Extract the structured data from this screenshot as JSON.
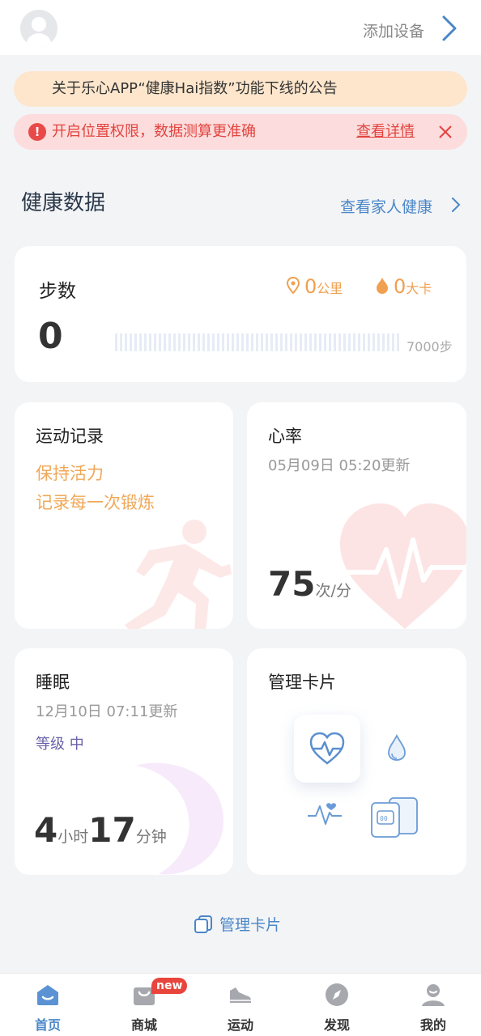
{
  "header": {
    "add_device_label": "添加设备"
  },
  "notices": {
    "announcement": "关于乐心APP“健康Hai指数”功能下线的公告",
    "location_prompt": "开启位置权限，数据测算更准确",
    "view_details": "查看详情"
  },
  "section": {
    "title": "健康数据",
    "family_link": "查看家人健康"
  },
  "steps": {
    "title": "步数",
    "value": "0",
    "distance_value": "0",
    "distance_unit": "公里",
    "calories_value": "0",
    "calories_unit": "大卡",
    "goal": "7000步",
    "progress": 0
  },
  "exercise": {
    "title": "运动记录",
    "line1": "保持活力",
    "line2": "记录每一次锻炼"
  },
  "heart_rate": {
    "title": "心率",
    "updated": "05月09日 05:20更新",
    "value": "75",
    "unit": "次/分"
  },
  "sleep": {
    "title": "睡眠",
    "updated": "12月10日 07:11更新",
    "level_label": "等级 中",
    "hours": "4",
    "hours_unit": "小时",
    "minutes": "17",
    "minutes_unit": "分钟"
  },
  "manage_card": {
    "title": "管理卡片"
  },
  "manage_link": "管理卡片",
  "nav": {
    "items": [
      {
        "label": "首页",
        "icon": "home-icon"
      },
      {
        "label": "商城",
        "icon": "shop-icon",
        "badge": "new"
      },
      {
        "label": "运动",
        "icon": "shoe-icon"
      },
      {
        "label": "发现",
        "icon": "compass-icon"
      },
      {
        "label": "我的",
        "icon": "profile-icon"
      }
    ]
  },
  "colors": {
    "accent_blue": "#4a86c8",
    "warning_red": "#e2443f",
    "orange": "#f0a050"
  }
}
